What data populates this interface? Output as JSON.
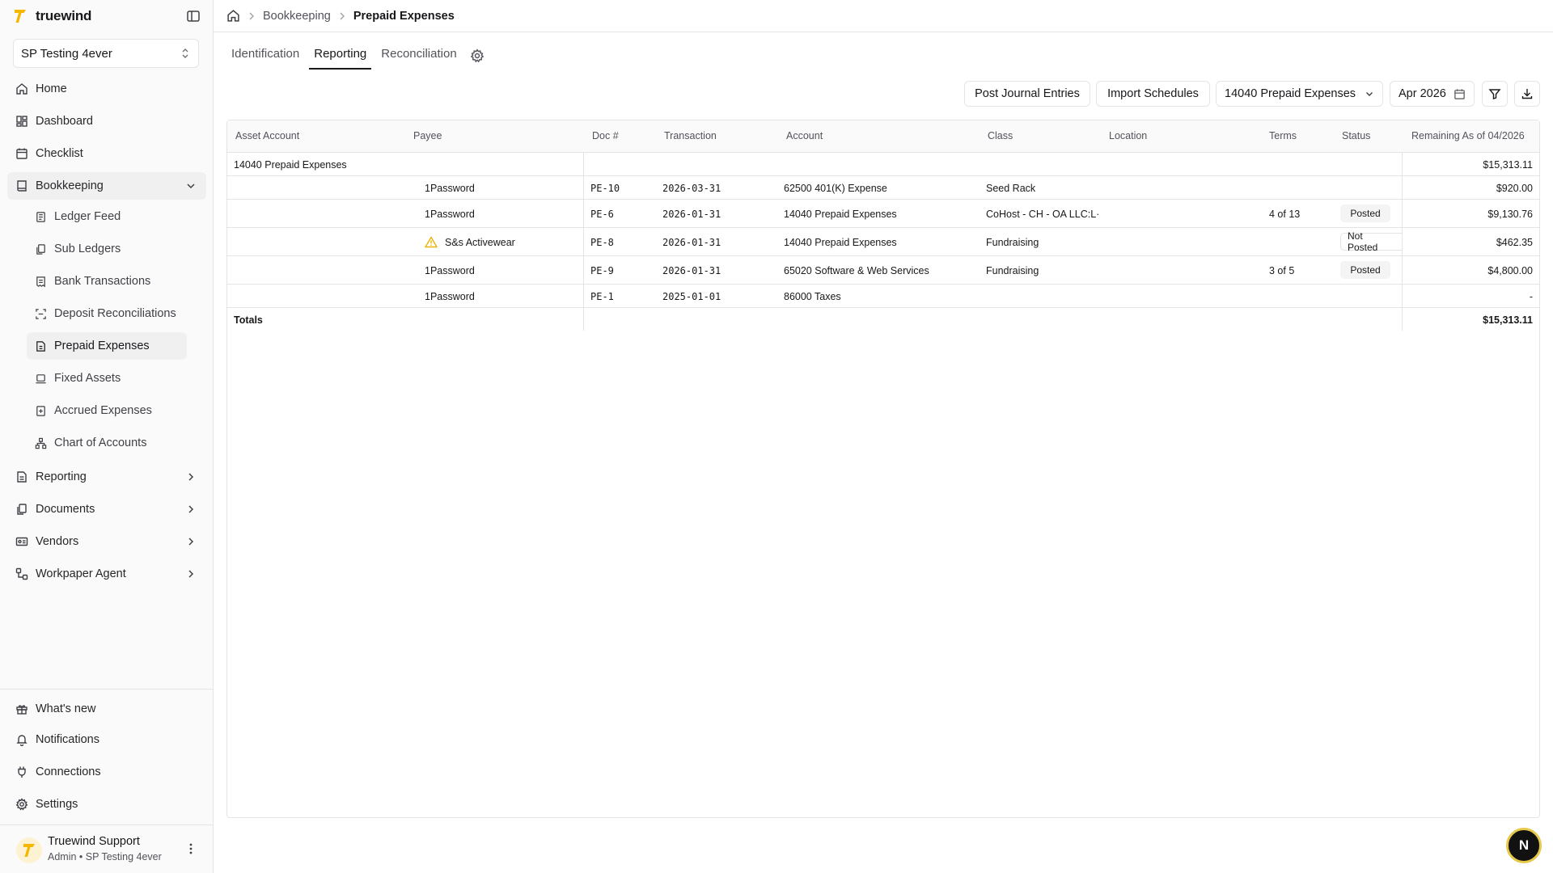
{
  "app": {
    "name": "truewind"
  },
  "company_selector": {
    "value": "SP Testing 4ever"
  },
  "nav": {
    "home": "Home",
    "dashboard": "Dashboard",
    "checklist": "Checklist",
    "bookkeeping": "Bookkeeping",
    "bookkeeping_items": [
      "Ledger Feed",
      "Sub Ledgers",
      "Bank Transactions",
      "Deposit Reconciliations",
      "Prepaid Expenses",
      "Fixed Assets",
      "Accrued Expenses",
      "Chart of Accounts"
    ],
    "reporting": "Reporting",
    "documents": "Documents",
    "vendors": "Vendors",
    "workpaper_agent": "Workpaper Agent"
  },
  "footer_nav": {
    "whats_new": "What's new",
    "notifications": "Notifications",
    "connections": "Connections",
    "settings": "Settings"
  },
  "user": {
    "name": "Truewind Support",
    "role": "Admin • SP Testing 4ever"
  },
  "breadcrumb": {
    "parent": "Bookkeeping",
    "current": "Prepaid Expenses"
  },
  "tabs": [
    "Identification",
    "Reporting",
    "Reconciliation"
  ],
  "toolbar": {
    "post_journal": "Post Journal Entries",
    "import_schedules": "Import Schedules",
    "account_filter": "14040 Prepaid Expenses",
    "period": "Apr 2026"
  },
  "table": {
    "headers": {
      "asset_account": "Asset Account",
      "payee": "Payee",
      "doc": "Doc #",
      "transaction": "Transaction",
      "account": "Account",
      "class": "Class",
      "location": "Location",
      "terms": "Terms",
      "status": "Status",
      "remaining": "Remaining As of 04/2026"
    },
    "group": {
      "asset_account": "14040 Prepaid Expenses",
      "remaining": "$15,313.11"
    },
    "rows": [
      {
        "payee": "1Password",
        "doc": "PE-10",
        "transaction": "2026-03-31",
        "account": "62500 401(K) Expense",
        "class": "Seed Rack",
        "terms": "",
        "status": "",
        "remaining": "$920.00"
      },
      {
        "payee": "1Password",
        "doc": "PE-6",
        "transaction": "2026-01-31",
        "account": "14040 Prepaid Expenses",
        "class": "CoHost - CH - OA LLC:L·",
        "terms": "4 of 13",
        "status": "Posted",
        "remaining": "$9,130.76"
      },
      {
        "payee": "S&s Activewear",
        "doc": "PE-8",
        "transaction": "2026-01-31",
        "account": "14040 Prepaid Expenses",
        "class": "Fundraising",
        "terms": "",
        "status": "Not Posted",
        "remaining": "$462.35",
        "warning": true
      },
      {
        "payee": "1Password",
        "doc": "PE-9",
        "transaction": "2026-01-31",
        "account": "65020 Software & Web Services",
        "class": "Fundraising",
        "terms": "3 of 5",
        "status": "Posted",
        "remaining": "$4,800.00"
      },
      {
        "payee": "1Password",
        "doc": "PE-1",
        "transaction": "2025-01-01",
        "account": "86000 Taxes",
        "class": "",
        "terms": "",
        "status": "",
        "remaining": "-"
      }
    ],
    "totals": {
      "label": "Totals",
      "remaining": "$15,313.11"
    }
  },
  "fab": {
    "label": "N"
  },
  "colors": {
    "brand": "#f5b700",
    "text": "#18181b",
    "muted": "#52525b",
    "border": "#e4e4e7",
    "warning": "#eab308"
  }
}
